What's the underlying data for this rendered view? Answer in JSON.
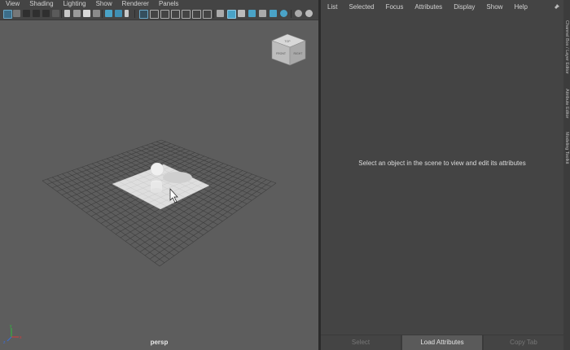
{
  "viewport": {
    "menu": [
      "View",
      "Shading",
      "Lighting",
      "Show",
      "Renderer",
      "Panels"
    ],
    "camera_label": "persp",
    "view_cube": {
      "face_front": "FRONT",
      "face_right": "RIGHT",
      "face_top": "TOP"
    },
    "axis": {
      "x": "x",
      "y": "y",
      "z": "z"
    }
  },
  "attribute_editor": {
    "menu": [
      "List",
      "Selected",
      "Focus",
      "Attributes",
      "Display",
      "Show",
      "Help"
    ],
    "message": "Select an object in the scene to view and edit its attributes",
    "buttons": {
      "select": "Select",
      "load": "Load Attributes",
      "copy_tab": "Copy Tab"
    }
  },
  "side_tabs": [
    "Channel Box / Layer Editor",
    "Attribute Editor",
    "Modeling Toolkit"
  ],
  "colors": {
    "viewport_bg": "#5d5d5d",
    "panel_bg": "#444444",
    "accent_blue": "#4aa3c7",
    "grid_line": "#3d3d3d",
    "plane": "#d9d9d9"
  }
}
